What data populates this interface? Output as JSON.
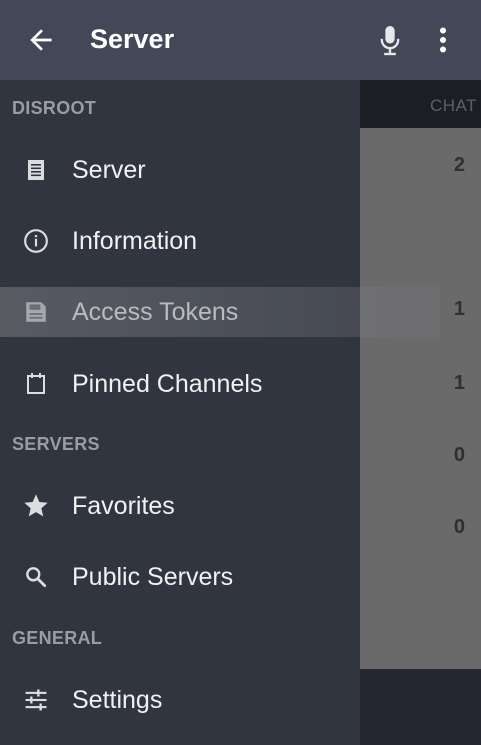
{
  "appbar": {
    "title": "Server",
    "back_icon": "arrow-back-icon",
    "mic_icon": "microphone-icon",
    "more_icon": "more-vert-icon"
  },
  "background": {
    "tab_label": "CHAT",
    "counts": [
      "2",
      "1",
      "1",
      "0",
      "0"
    ]
  },
  "drawer": {
    "sections": [
      {
        "header": "DISROOT",
        "items": [
          {
            "label": "Server",
            "icon": "document-list-icon"
          },
          {
            "label": "Information",
            "icon": "info-icon"
          },
          {
            "label": "Access Tokens",
            "icon": "save-icon",
            "active": true
          },
          {
            "label": "Pinned Channels",
            "icon": "calendar-icon"
          }
        ]
      },
      {
        "header": "SERVERS",
        "items": [
          {
            "label": "Favorites",
            "icon": "star-icon"
          },
          {
            "label": "Public Servers",
            "icon": "search-icon"
          }
        ]
      },
      {
        "header": "GENERAL",
        "items": [
          {
            "label": "Settings",
            "icon": "sliders-icon"
          }
        ]
      }
    ]
  },
  "colors": {
    "appbar": "#434859",
    "drawer": "#31353f",
    "section_header": "#9a9ca3",
    "item_text": "#f1f1f3"
  }
}
